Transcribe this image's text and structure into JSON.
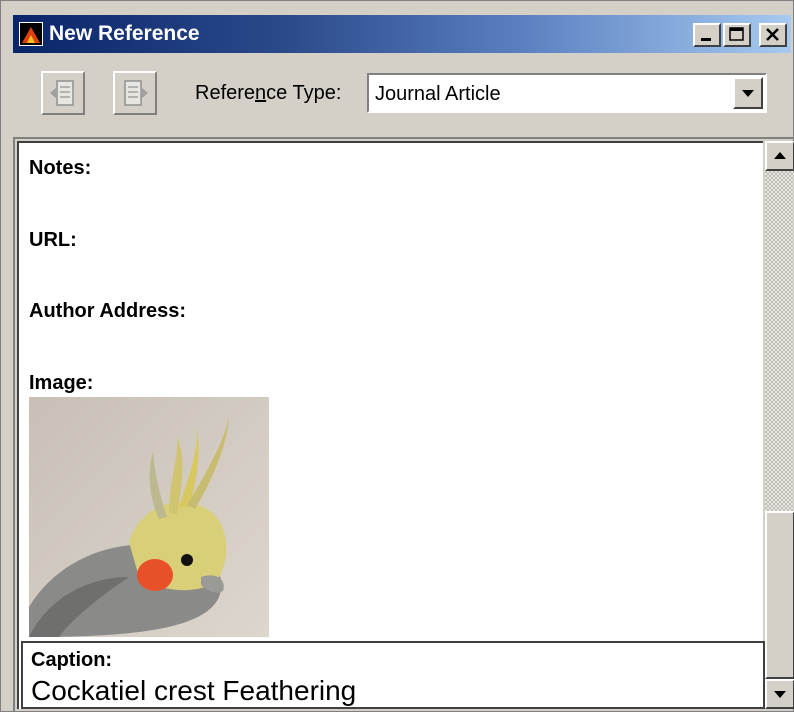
{
  "window": {
    "title": "New Reference",
    "accent": "#0a246a",
    "icons": {
      "app": "app-icon",
      "minimize": "minimize-icon",
      "maximize": "maximize-icon",
      "close": "close-icon"
    }
  },
  "toolbar": {
    "reftype_label_before": "Refere",
    "reftype_label_accel": "n",
    "reftype_label_after": "ce Type:",
    "reftype_value": "Journal Article",
    "buttons": [
      "previous-reference-icon",
      "next-reference-icon"
    ]
  },
  "fields": {
    "notes": "Notes:",
    "url": "URL:",
    "author_address": "Author Address:",
    "image": "Image:"
  },
  "caption": {
    "label": "Caption:",
    "text": "Cockatiel crest Feathering"
  }
}
